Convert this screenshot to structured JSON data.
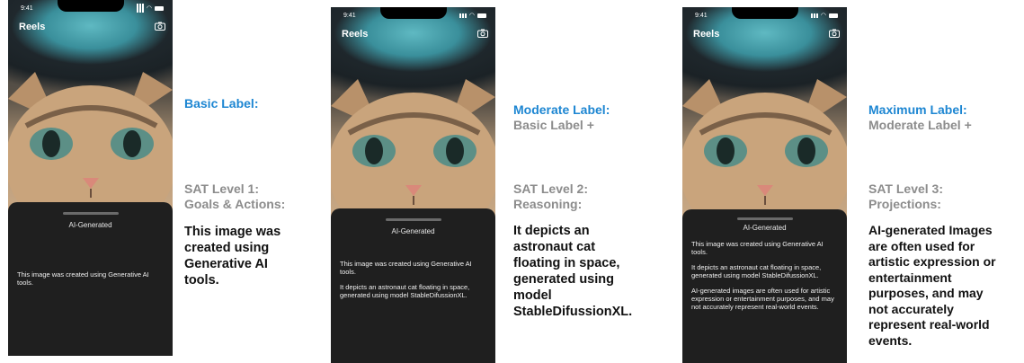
{
  "status_bar": {
    "time": "9:41"
  },
  "phone": {
    "header_title": "Reels",
    "sheet_title": "AI-Generated"
  },
  "panels": [
    {
      "label_title": "Basic Label:",
      "label_sub": "",
      "sat_level": "SAT Level 1:",
      "sat_name": "Goals & Actions:",
      "description_lines": [
        "This image was",
        "created using",
        "Generative AI",
        "tools."
      ],
      "sheet_paragraphs": [
        "This image was created using Generative AI tools."
      ]
    },
    {
      "label_title": "Moderate Label:",
      "label_sub": "Basic Label +",
      "sat_level": "SAT Level 2:",
      "sat_name": "Reasoning:",
      "description_lines": [
        "It depicts an",
        "astronaut cat",
        "floating in space,",
        "generated using",
        "model",
        "StableDifussionXL."
      ],
      "sheet_paragraphs": [
        "This image was created using Generative AI tools.",
        "It depicts an astronaut cat floating in space, generated using model StableDifussionXL."
      ]
    },
    {
      "label_title": "Maximum Label:",
      "label_sub": "Moderate Label +",
      "sat_level": "SAT Level 3:",
      "sat_name": "Projections:",
      "description_lines": [
        "AI-generated Images",
        "are often used for",
        "artistic expression or",
        "entertainment",
        "purposes, and may",
        "not accurately",
        "represent real-world",
        "events."
      ],
      "sheet_paragraphs": [
        "This image was created using Generative AI tools.",
        "It depicts an astronaut cat floating in space, generated using model StableDifussionXL.",
        "AI-generated images are often used for artistic expression or entertainment purposes, and may not accurately represent real-world events."
      ]
    }
  ]
}
